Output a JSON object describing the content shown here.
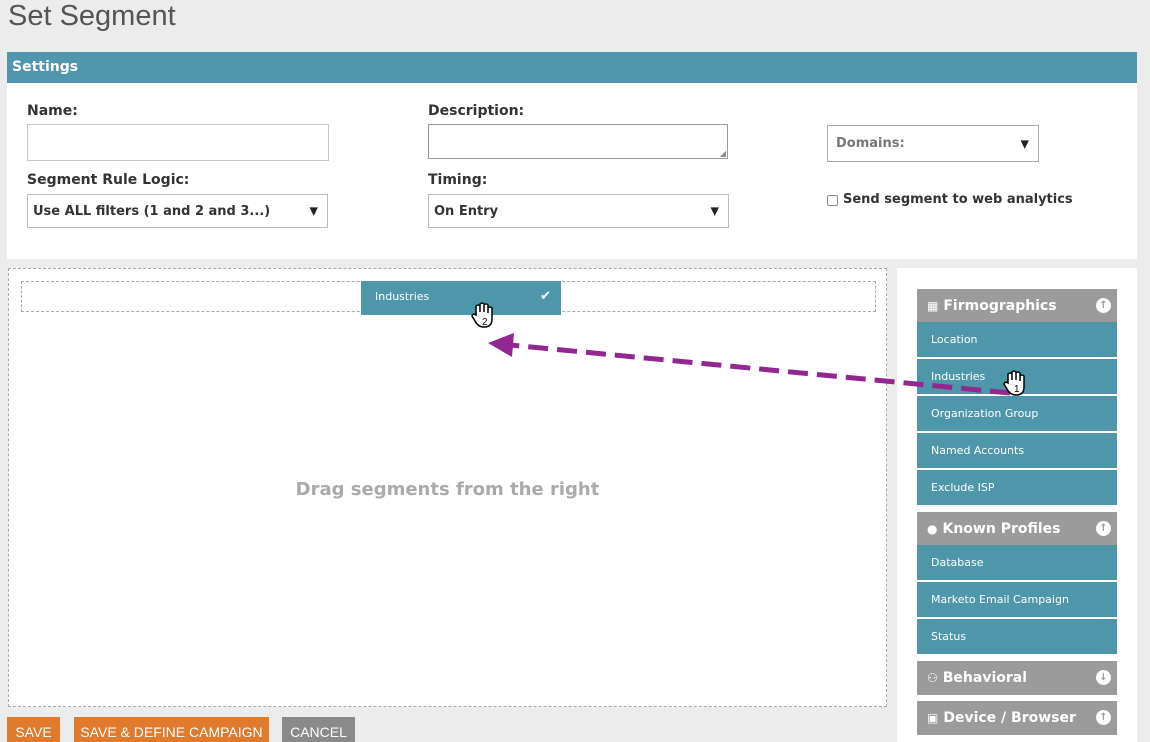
{
  "page": {
    "title": "Set Segment"
  },
  "settings": {
    "header": "Settings",
    "name_label": "Name:",
    "name_value": "",
    "description_label": "Description:",
    "description_value": "",
    "domains_placeholder": "Domains:",
    "rule_logic_label": "Segment Rule Logic:",
    "rule_logic_value": "Use ALL filters (1 and 2 and 3...)",
    "timing_label": "Timing:",
    "timing_value": "On Entry",
    "web_analytics_label": "Send segment to web analytics",
    "web_analytics_checked": false
  },
  "drop_area": {
    "hint": "Drag segments from the right",
    "dragged_chip": "Industries"
  },
  "sidebar": {
    "categories": [
      {
        "label": "Firmographics",
        "icon": "building-icon",
        "expanded": true,
        "items": [
          "Location",
          "Industries",
          "Organization Group",
          "Named Accounts",
          "Exclude ISP"
        ]
      },
      {
        "label": "Known Profiles",
        "icon": "person-icon",
        "expanded": true,
        "items": [
          "Database",
          "Marketo Email Campaign",
          "Status"
        ]
      },
      {
        "label": "Behavioral",
        "icon": "people-icon",
        "expanded": false,
        "items": []
      },
      {
        "label": "Device / Browser",
        "icon": "monitor-icon",
        "expanded": true,
        "items": []
      }
    ]
  },
  "actions": {
    "save": "SAVE",
    "save_define": "SAVE & DEFINE CAMPAIGN",
    "cancel": "CANCEL"
  },
  "annotations": {
    "step_1": "1",
    "step_2": "2",
    "arrow_color": "#93278f"
  }
}
